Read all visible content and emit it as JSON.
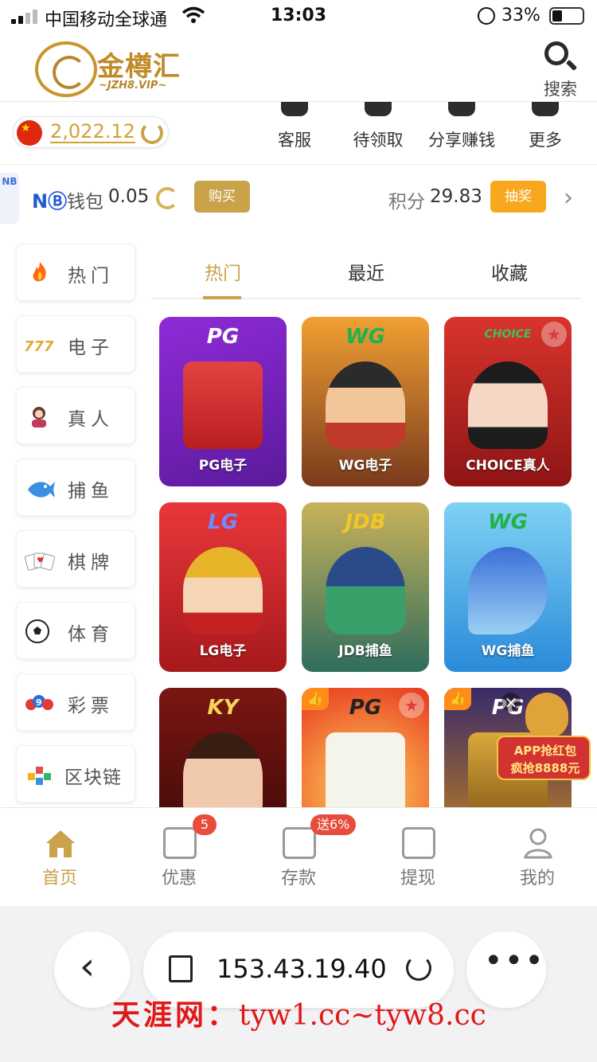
{
  "status_bar": {
    "carrier": "中国移动全球通",
    "time": "13:03",
    "battery": "33%"
  },
  "header": {
    "logo_name": "金樽汇",
    "logo_domain": "~JZH8.VIP~",
    "search_label": "搜索"
  },
  "account": {
    "balance": "2,022.12",
    "quick_actions": [
      {
        "label": "客服",
        "icon": "customer-service-icon"
      },
      {
        "label": "待领取",
        "icon": "gift-box-icon"
      },
      {
        "label": "分享赚钱",
        "icon": "share-icon"
      },
      {
        "label": "更多",
        "icon": "more-grid-icon"
      }
    ]
  },
  "wallet": {
    "side_tab": "NB",
    "brand": "NⒷ",
    "wallet_label": "钱包",
    "wallet_value": "0.05",
    "buy_label": "购买",
    "points_label": "积分",
    "points_value": "29.83",
    "draw_label": "抽奖"
  },
  "categories": [
    {
      "label": "热门",
      "icon": "fire-icon"
    },
    {
      "label": "电子",
      "icon": "slot-777-icon"
    },
    {
      "label": "真人",
      "icon": "live-dealer-icon"
    },
    {
      "label": "捕鱼",
      "icon": "fish-icon"
    },
    {
      "label": "棋牌",
      "icon": "cards-icon"
    },
    {
      "label": "体育",
      "icon": "soccer-ball-icon"
    },
    {
      "label": "彩票",
      "icon": "lottery-balls-icon"
    },
    {
      "label": "区块链",
      "icon": "blockchain-cubes-icon"
    }
  ],
  "tabs": [
    "热门",
    "最近",
    "收藏"
  ],
  "games": [
    {
      "brand": "PG",
      "caption": "PG电子"
    },
    {
      "brand": "WG",
      "caption": "WG电子"
    },
    {
      "brand": "CHOICE",
      "caption": "CHOICE真人"
    },
    {
      "brand": "LG",
      "caption": "LG电子"
    },
    {
      "brand": "JDB",
      "caption": "JDB捕鱼"
    },
    {
      "brand": "WG",
      "caption": "WG捕鱼"
    },
    {
      "brand": "KY",
      "caption": ""
    },
    {
      "brand": "PG",
      "caption": ""
    },
    {
      "brand": "PG",
      "caption": ""
    }
  ],
  "promo": {
    "line1": "APP抢红包",
    "line2": "疯抢8888元"
  },
  "bottom_nav": [
    {
      "label": "首页",
      "icon": "home-icon",
      "badge": ""
    },
    {
      "label": "优惠",
      "icon": "gift-icon",
      "badge": "5"
    },
    {
      "label": "存款",
      "icon": "wallet-icon",
      "badge": "送6%"
    },
    {
      "label": "提现",
      "icon": "withdraw-icon",
      "badge": ""
    },
    {
      "label": "我的",
      "icon": "profile-icon",
      "badge": ""
    }
  ],
  "browser": {
    "url": "153.43.19.40",
    "back_glyph": "‹",
    "more_glyph": "•••"
  },
  "watermark": {
    "zh": "天涯网：",
    "en": "tyw1.cc~tyw8.cc"
  },
  "colors": {
    "gold": "#c9a24a",
    "orange": "#f8a81e",
    "badge_red": "#e74c3c"
  }
}
